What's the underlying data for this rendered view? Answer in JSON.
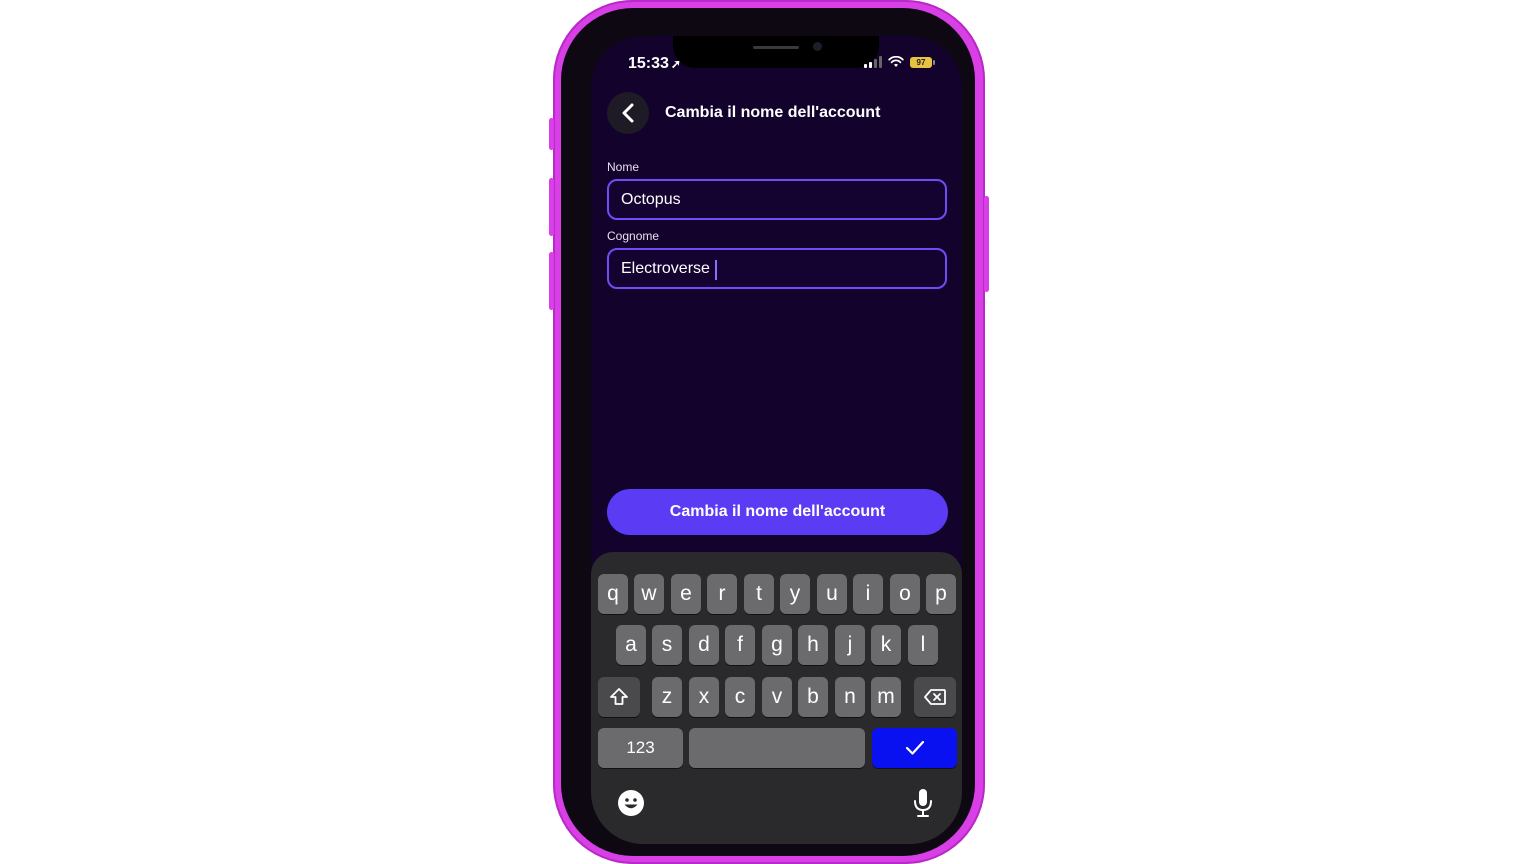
{
  "status_bar": {
    "time": "15:33",
    "location_arrow": "➤",
    "battery_level": "97"
  },
  "header": {
    "title": "Cambia il nome dell'account",
    "back_icon": "chevron-left-icon"
  },
  "form": {
    "first_name_label": "Nome",
    "first_name_value": "Octopus",
    "last_name_label": "Cognome",
    "last_name_value": "Electroverse"
  },
  "submit_label": "Cambia il nome dell'account",
  "keyboard": {
    "row1": [
      "q",
      "w",
      "e",
      "r",
      "t",
      "y",
      "u",
      "i",
      "o",
      "p"
    ],
    "row2": [
      "a",
      "s",
      "d",
      "f",
      "g",
      "h",
      "j",
      "k",
      "l"
    ],
    "row3": [
      "z",
      "x",
      "c",
      "v",
      "b",
      "n",
      "m"
    ],
    "numbers_label": "123",
    "accent_color": "#0a11f0"
  },
  "colors": {
    "phone_frame": "#d93fe6",
    "screen_bg": "#13022b",
    "primary": "#5b3cf4",
    "field_border": "#6f4cf5"
  }
}
